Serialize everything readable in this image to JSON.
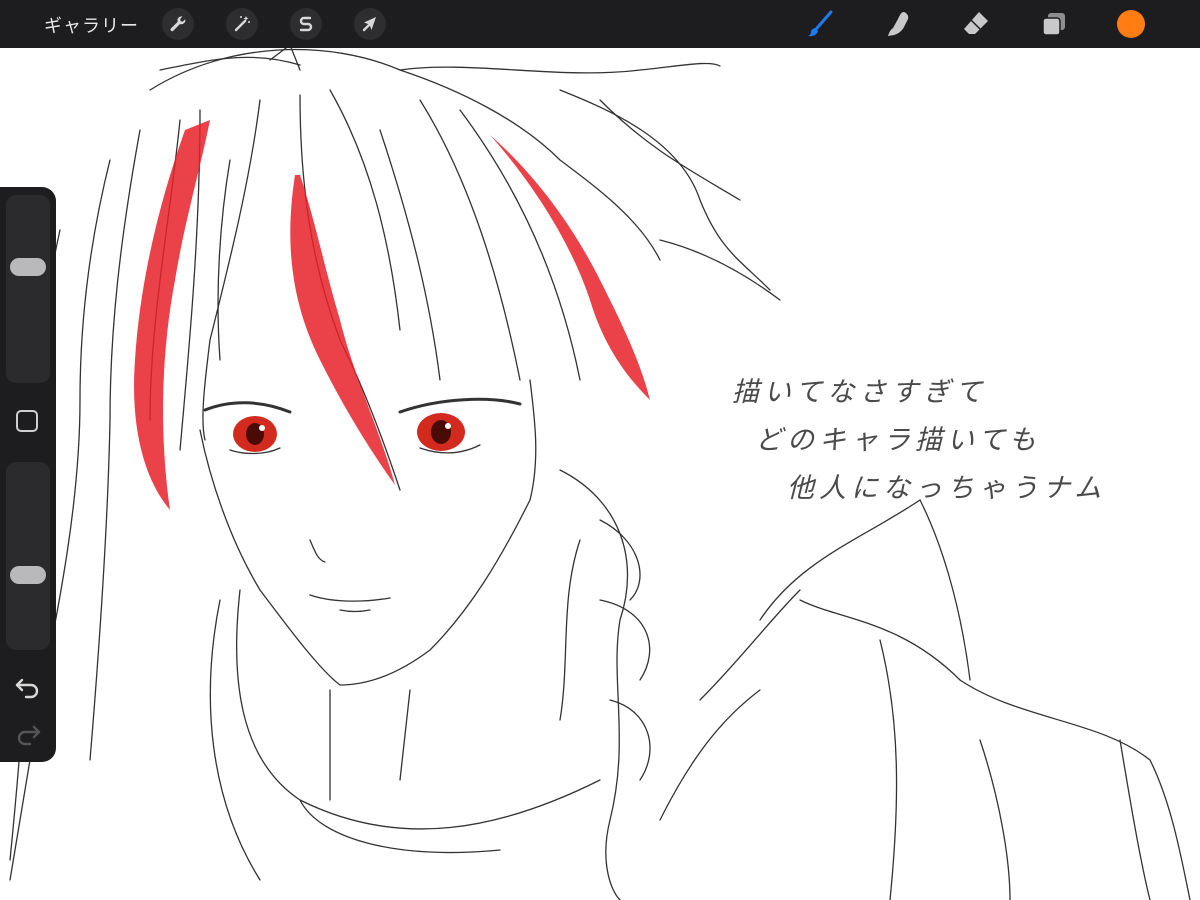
{
  "app": {
    "gallery_label": "ギャラリー"
  },
  "toolbar": {
    "left_tools": [
      {
        "name": "actions",
        "icon": "wrench-icon"
      },
      {
        "name": "adjustments",
        "icon": "magic-wand-icon"
      },
      {
        "name": "selection",
        "icon": "selection-s-icon"
      },
      {
        "name": "transform",
        "icon": "arrow-cursor-icon"
      }
    ],
    "right_tools": [
      {
        "name": "brush",
        "icon": "brush-icon",
        "active": true
      },
      {
        "name": "smudge",
        "icon": "smudge-finger-icon",
        "active": false
      },
      {
        "name": "eraser",
        "icon": "eraser-icon",
        "active": false
      },
      {
        "name": "layers",
        "icon": "layers-icon",
        "active": false
      }
    ],
    "current_color": "#ff7d12",
    "active_color": "#1e7cf2"
  },
  "sidebar": {
    "brush_size_level": 0.64,
    "opacity_level": 0.38,
    "modify_icon": "square-modify-icon",
    "undo_icon": "undo-icon",
    "redo_icon": "redo-icon"
  },
  "canvas": {
    "note_lines": [
      "描いてなさすぎて",
      "どのキャラ描いても",
      "他人になっちゃうナム"
    ],
    "accent_red": "#e8212a",
    "line_color": "#333333"
  }
}
